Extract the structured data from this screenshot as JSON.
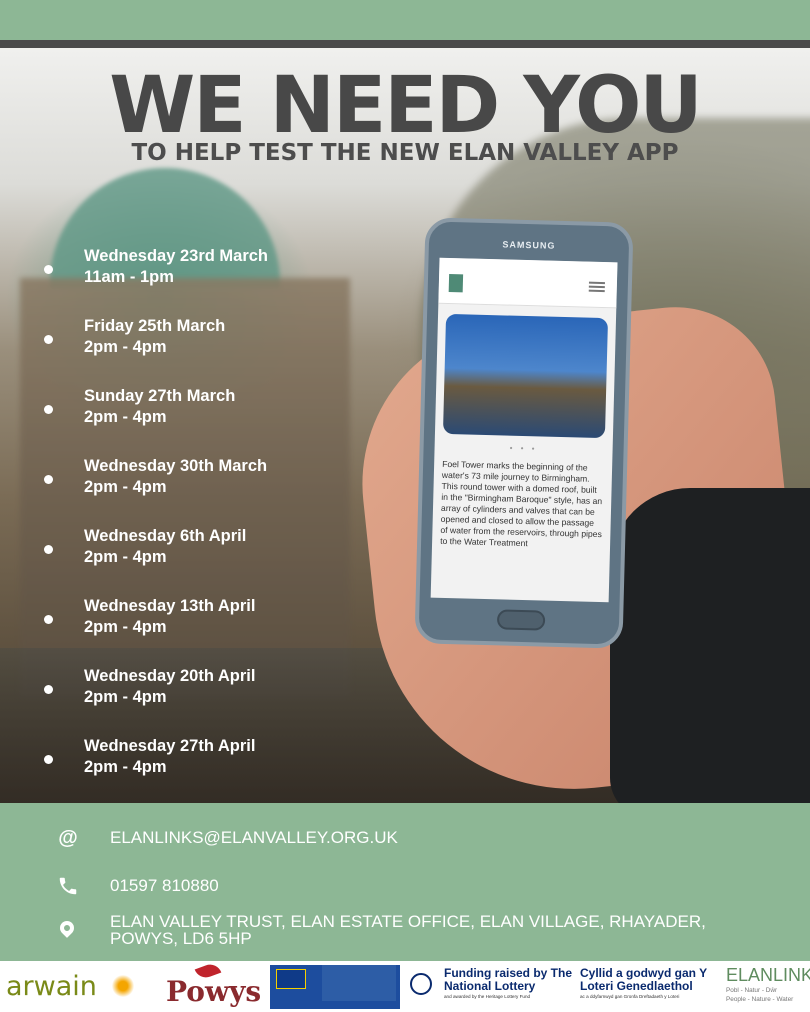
{
  "headline": "WE NEED YOU",
  "subheadline": "TO HELP TEST THE NEW ELAN VALLEY APP",
  "dates": [
    {
      "day": "Wednesday 23rd March",
      "time": "11am - 1pm"
    },
    {
      "day": "Friday 25th March",
      "time": "2pm - 4pm"
    },
    {
      "day": "Sunday 27th March",
      "time": "2pm - 4pm"
    },
    {
      "day": "Wednesday 30th March",
      "time": "2pm - 4pm"
    },
    {
      "day": "Wednesday 6th April",
      "time": "2pm - 4pm"
    },
    {
      "day": "Wednesday 13th April",
      "time": "2pm - 4pm"
    },
    {
      "day": "Wednesday 20th April",
      "time": "2pm - 4pm"
    },
    {
      "day": "Wednesday 27th April",
      "time": "2pm - 4pm"
    }
  ],
  "phone": {
    "brand": "SAMSUNG",
    "dots": "• • •",
    "text": "Foel Tower marks the beginning of the water's 73 mile journey to Birmingham. This round tower with a domed roof, built in the \"Birmingham Baroque\" style, has an array of cylinders and valves that can be opened and closed to allow the passage of water from the reservoirs, through pipes to the Water Treatment"
  },
  "contact": {
    "email_icon": "@",
    "email": "ELANLINKS@ELANVALLEY.ORG.UK",
    "phone_icon": "phone-icon",
    "phone": "01597 810880",
    "address_icon": "location-pin-icon",
    "address": "ELAN VALLEY TRUST, ELAN ESTATE OFFICE, ELAN VILLAGE, RHAYADER, POWYS, LD6 5HP"
  },
  "logos": {
    "arwain": "arwain",
    "powys": "Powys",
    "lottery_en_title": "Funding raised by The National Lottery",
    "lottery_en_sub": "and awarded by the Heritage Lottery Fund",
    "lottery_cy_title": "Cyllid a godwyd gan Y Loteri Genedlaethol",
    "lottery_cy_sub": "ac a ddyfarnwyd gan Gronfa Dreftadaeth y Loteri",
    "elanlinks_title": "ELANLINKS",
    "elanlinks_sub1": "Pobl - Natur - Dŵr",
    "elanlinks_sub2": "People - Nature - Water"
  },
  "colors": {
    "accent_green": "#8db795",
    "headline_gray": "#484848"
  }
}
